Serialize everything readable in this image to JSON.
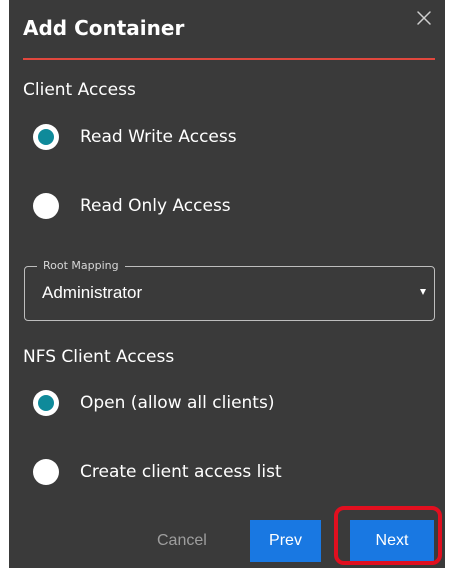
{
  "dialog": {
    "title": "Add Container",
    "close_icon": "close-icon"
  },
  "client_access": {
    "heading": "Client Access",
    "options": [
      {
        "label": "Read Write Access",
        "selected": true
      },
      {
        "label": "Read Only Access",
        "selected": false
      }
    ]
  },
  "root_mapping": {
    "legend": "Root Mapping",
    "value": "Administrator",
    "dropdown_icon": "chevron-down-icon"
  },
  "nfs_client_access": {
    "heading": "NFS Client Access",
    "options": [
      {
        "label": "Open (allow all clients)",
        "selected": true
      },
      {
        "label": "Create client access list",
        "selected": false
      }
    ]
  },
  "footer": {
    "cancel_label": "Cancel",
    "prev_label": "Prev",
    "next_label": "Next"
  },
  "colors": {
    "dialog_background": "#3a3a3a",
    "title_rule": "#e1473d",
    "radio_selected": "#0f8a9a",
    "primary_button": "#1978e2",
    "highlight": "#e10f1f",
    "cancel_text": "#9e9e9e"
  }
}
